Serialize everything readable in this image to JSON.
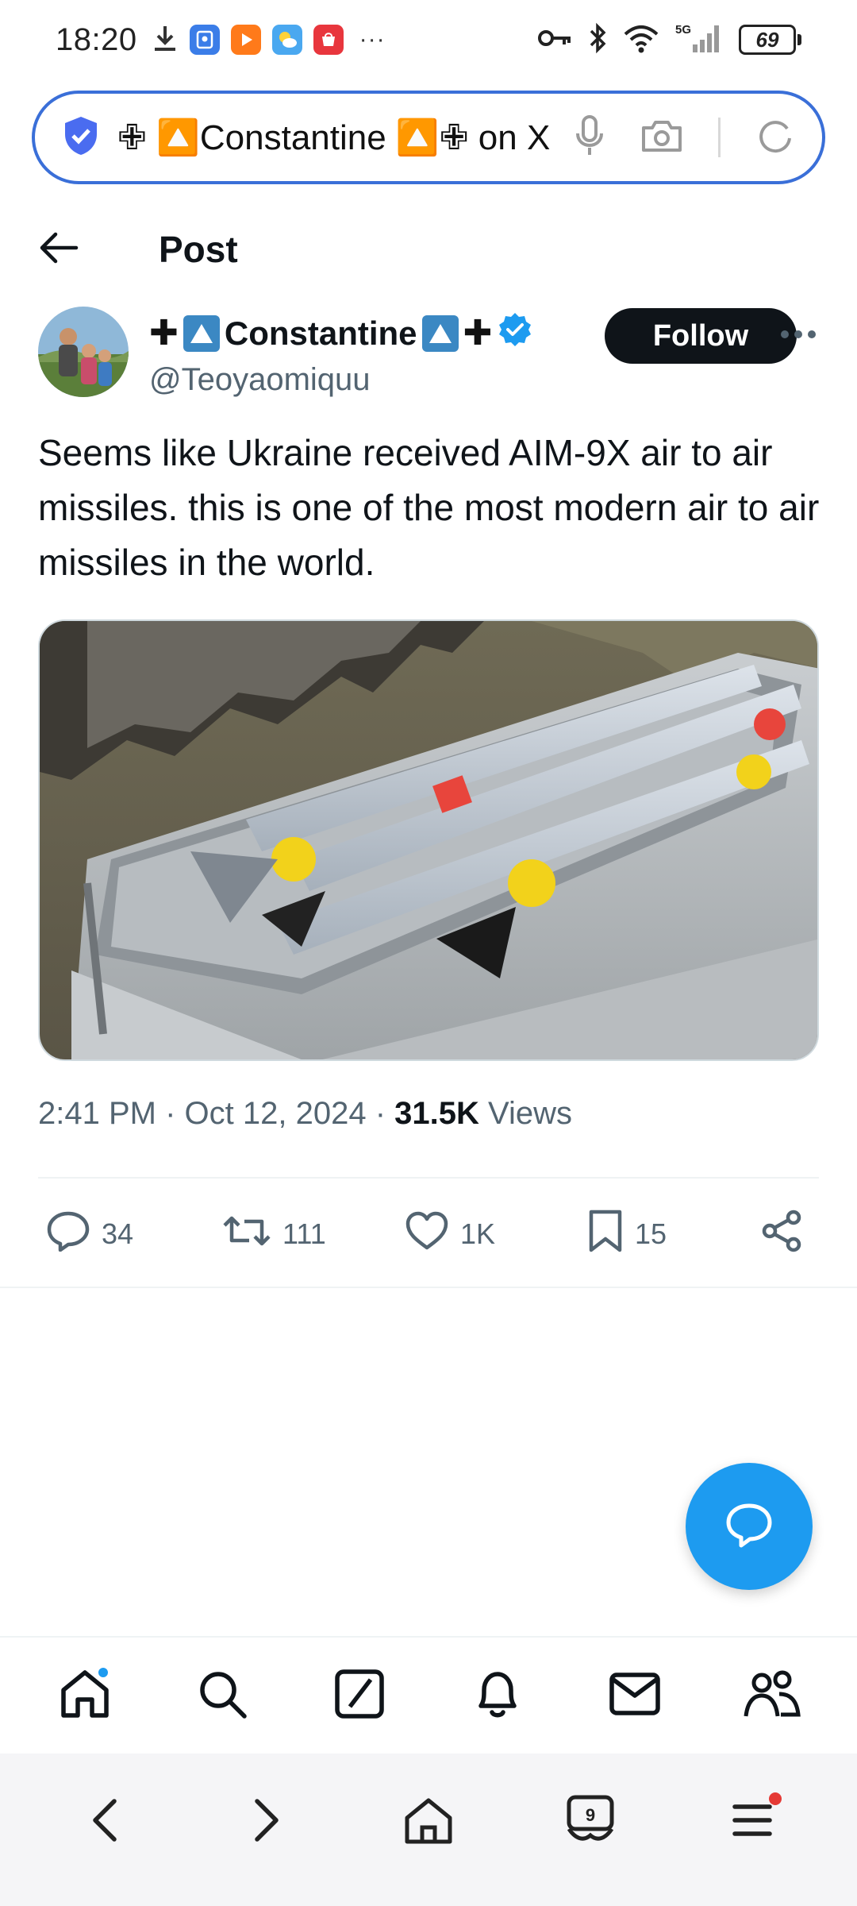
{
  "status_bar": {
    "time": "18:20",
    "battery": "69",
    "network": "5G"
  },
  "address_bar": {
    "url_text": "✙ 🔼Constantine 🔼✙ on X"
  },
  "header": {
    "title": "Post"
  },
  "post": {
    "author_name": "Constantine",
    "author_handle": "@Teoyaomiquu",
    "follow_label": "Follow",
    "text": "Seems like Ukraine received AIM-9X air to air missiles. this is one of the most modern air to air missiles in the world.",
    "time": "2:41 PM",
    "date": "Oct 12, 2024",
    "views_count": "31.5K",
    "views_label": "Views",
    "separator": "·"
  },
  "actions": {
    "replies": "34",
    "reposts": "111",
    "likes": "1K",
    "bookmarks": "15"
  },
  "browser": {
    "tab_count": "9"
  },
  "colors": {
    "accent": "#1d9bf0",
    "address_border": "#3a6fd8",
    "text_primary": "#0f1419",
    "text_secondary": "#536471"
  }
}
